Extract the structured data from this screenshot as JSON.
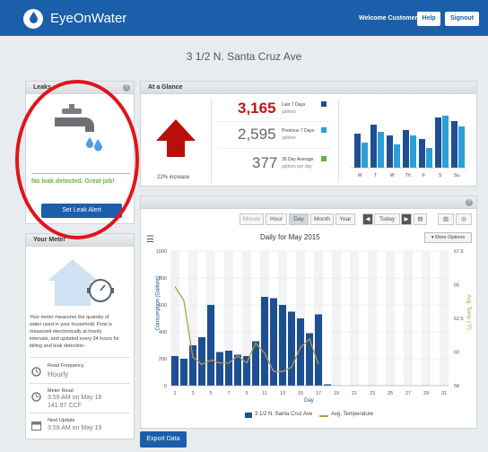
{
  "header": {
    "brand": "EyeOnWater",
    "welcome": "Welcome Customer",
    "help": "Help",
    "signout": "Signout"
  },
  "address": "3 1/2 N. Santa Cruz Ave",
  "leaks": {
    "title": "Leaks",
    "status": "No leak detected. Great job!",
    "button": "Set Leak Alert"
  },
  "meter": {
    "title": "Your Meter",
    "description_lines": [
      "Your meter measures the quantity of",
      "water used in your household. Flow is",
      "measured electronically at hourly",
      "intervals, and updated every 24 hours for",
      "billing and leak detection."
    ],
    "read_frequency_label": "Read Frequency",
    "read_frequency": "Hourly",
    "meter_read_label": "Meter Read",
    "meter_read_time": "3:59 AM on May 18",
    "meter_read_value": "141.97 CCF",
    "next_update_label": "Next Update",
    "next_update": "3:59 AM on May 19",
    "dial_label": "BADGER"
  },
  "glance": {
    "title": "At a Glance",
    "increase": "22% increase",
    "last7": "3,165",
    "last7_label": "Last 7 Days",
    "last7_unit": "gallons",
    "prev7": "2,595",
    "prev7_label": "Previous 7 Days",
    "prev7_unit": "gallons",
    "avg30": "377",
    "avg30_label": "30 Day Average",
    "avg30_unit": "gallons per day",
    "days": [
      "M",
      "T",
      "W",
      "Th",
      "F",
      "S",
      "Su"
    ],
    "colors": {
      "last7": "#1d4f93",
      "prev7": "#2a9fd8",
      "avg30": "#6ab04c",
      "increase": "#b80f0a"
    }
  },
  "controls": {
    "ranges": [
      "Minute",
      "Hour",
      "Day",
      "Month",
      "Year"
    ],
    "selected": "Day",
    "today": "Today",
    "more_options": "▾ More Options",
    "export": "Export Data"
  },
  "chart_data": {
    "type": "bar",
    "title": "Daily for May 2015",
    "xlabel": "Day",
    "ylabel": "Consumption (Gallons)",
    "y2label": "Avg. Temp (°F)",
    "x_ticks": [
      "1",
      "3",
      "5",
      "7",
      "9",
      "11",
      "13",
      "15",
      "17",
      "19",
      "21",
      "23",
      "25",
      "27",
      "29",
      "31"
    ],
    "y_ticks": [
      "0",
      "200",
      "400",
      "600",
      "800",
      "1000"
    ],
    "y2_ticks": [
      "58",
      "60",
      "62.5",
      "65",
      "67.5"
    ],
    "ylim": [
      0,
      1000
    ],
    "y2lim": [
      58,
      67.5
    ],
    "days": [
      1,
      2,
      3,
      4,
      5,
      6,
      7,
      8,
      9,
      10,
      11,
      12,
      13,
      14,
      15,
      16,
      17,
      18
    ],
    "series": [
      {
        "name": "3 1/2 N. Santa Cruz Ave",
        "values": [
          220,
          200,
          300,
          360,
          600,
          250,
          260,
          230,
          220,
          330,
          660,
          650,
          600,
          550,
          500,
          390,
          530,
          10
        ],
        "color": "#1d4f93"
      },
      {
        "name": "Avg. Temperature",
        "values": [
          65,
          64,
          60,
          59.5,
          59.8,
          59.6,
          59.6,
          60.1,
          59.6,
          61,
          60.3,
          59,
          59,
          59.3,
          60.7,
          61.3,
          59.5
        ],
        "color": "#b39b49"
      }
    ]
  }
}
